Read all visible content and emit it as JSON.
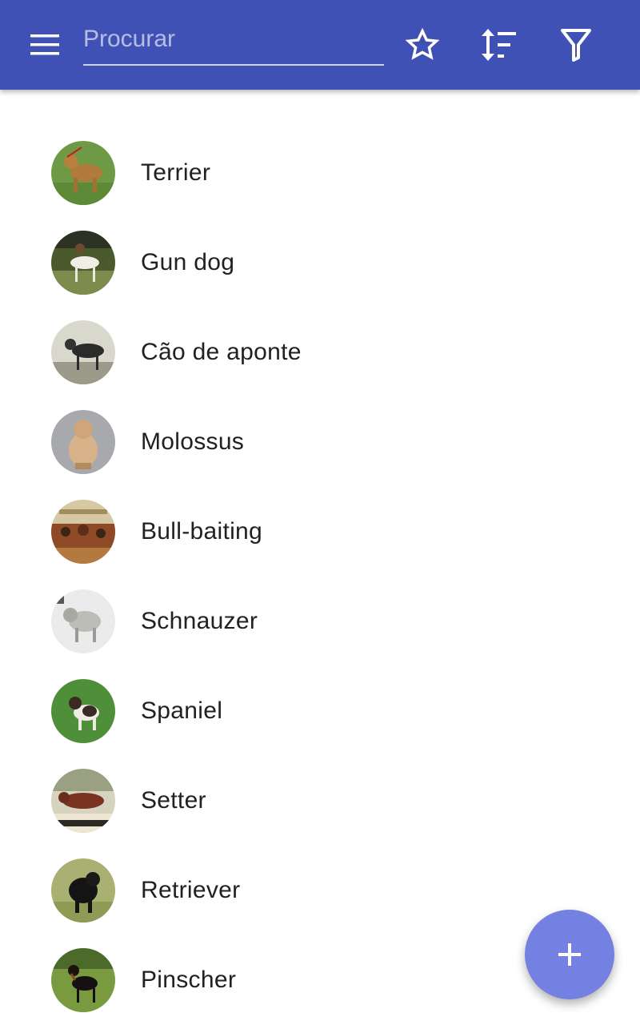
{
  "search": {
    "placeholder": "Procurar",
    "value": ""
  },
  "toolbar": {
    "icons": [
      "menu-icon",
      "star-icon",
      "sort-icon",
      "filter-icon"
    ]
  },
  "colors": {
    "appbar": "#3f51b5",
    "fab": "#7580e3",
    "text": "#212121"
  },
  "list": {
    "items": [
      {
        "label": "Terrier"
      },
      {
        "label": "Gun dog"
      },
      {
        "label": "Cão de aponte"
      },
      {
        "label": "Molossus"
      },
      {
        "label": "Bull-baiting"
      },
      {
        "label": "Schnauzer"
      },
      {
        "label": "Spaniel"
      },
      {
        "label": "Setter"
      },
      {
        "label": "Retriever"
      },
      {
        "label": "Pinscher"
      }
    ]
  },
  "fab": {
    "icon": "plus-icon"
  }
}
